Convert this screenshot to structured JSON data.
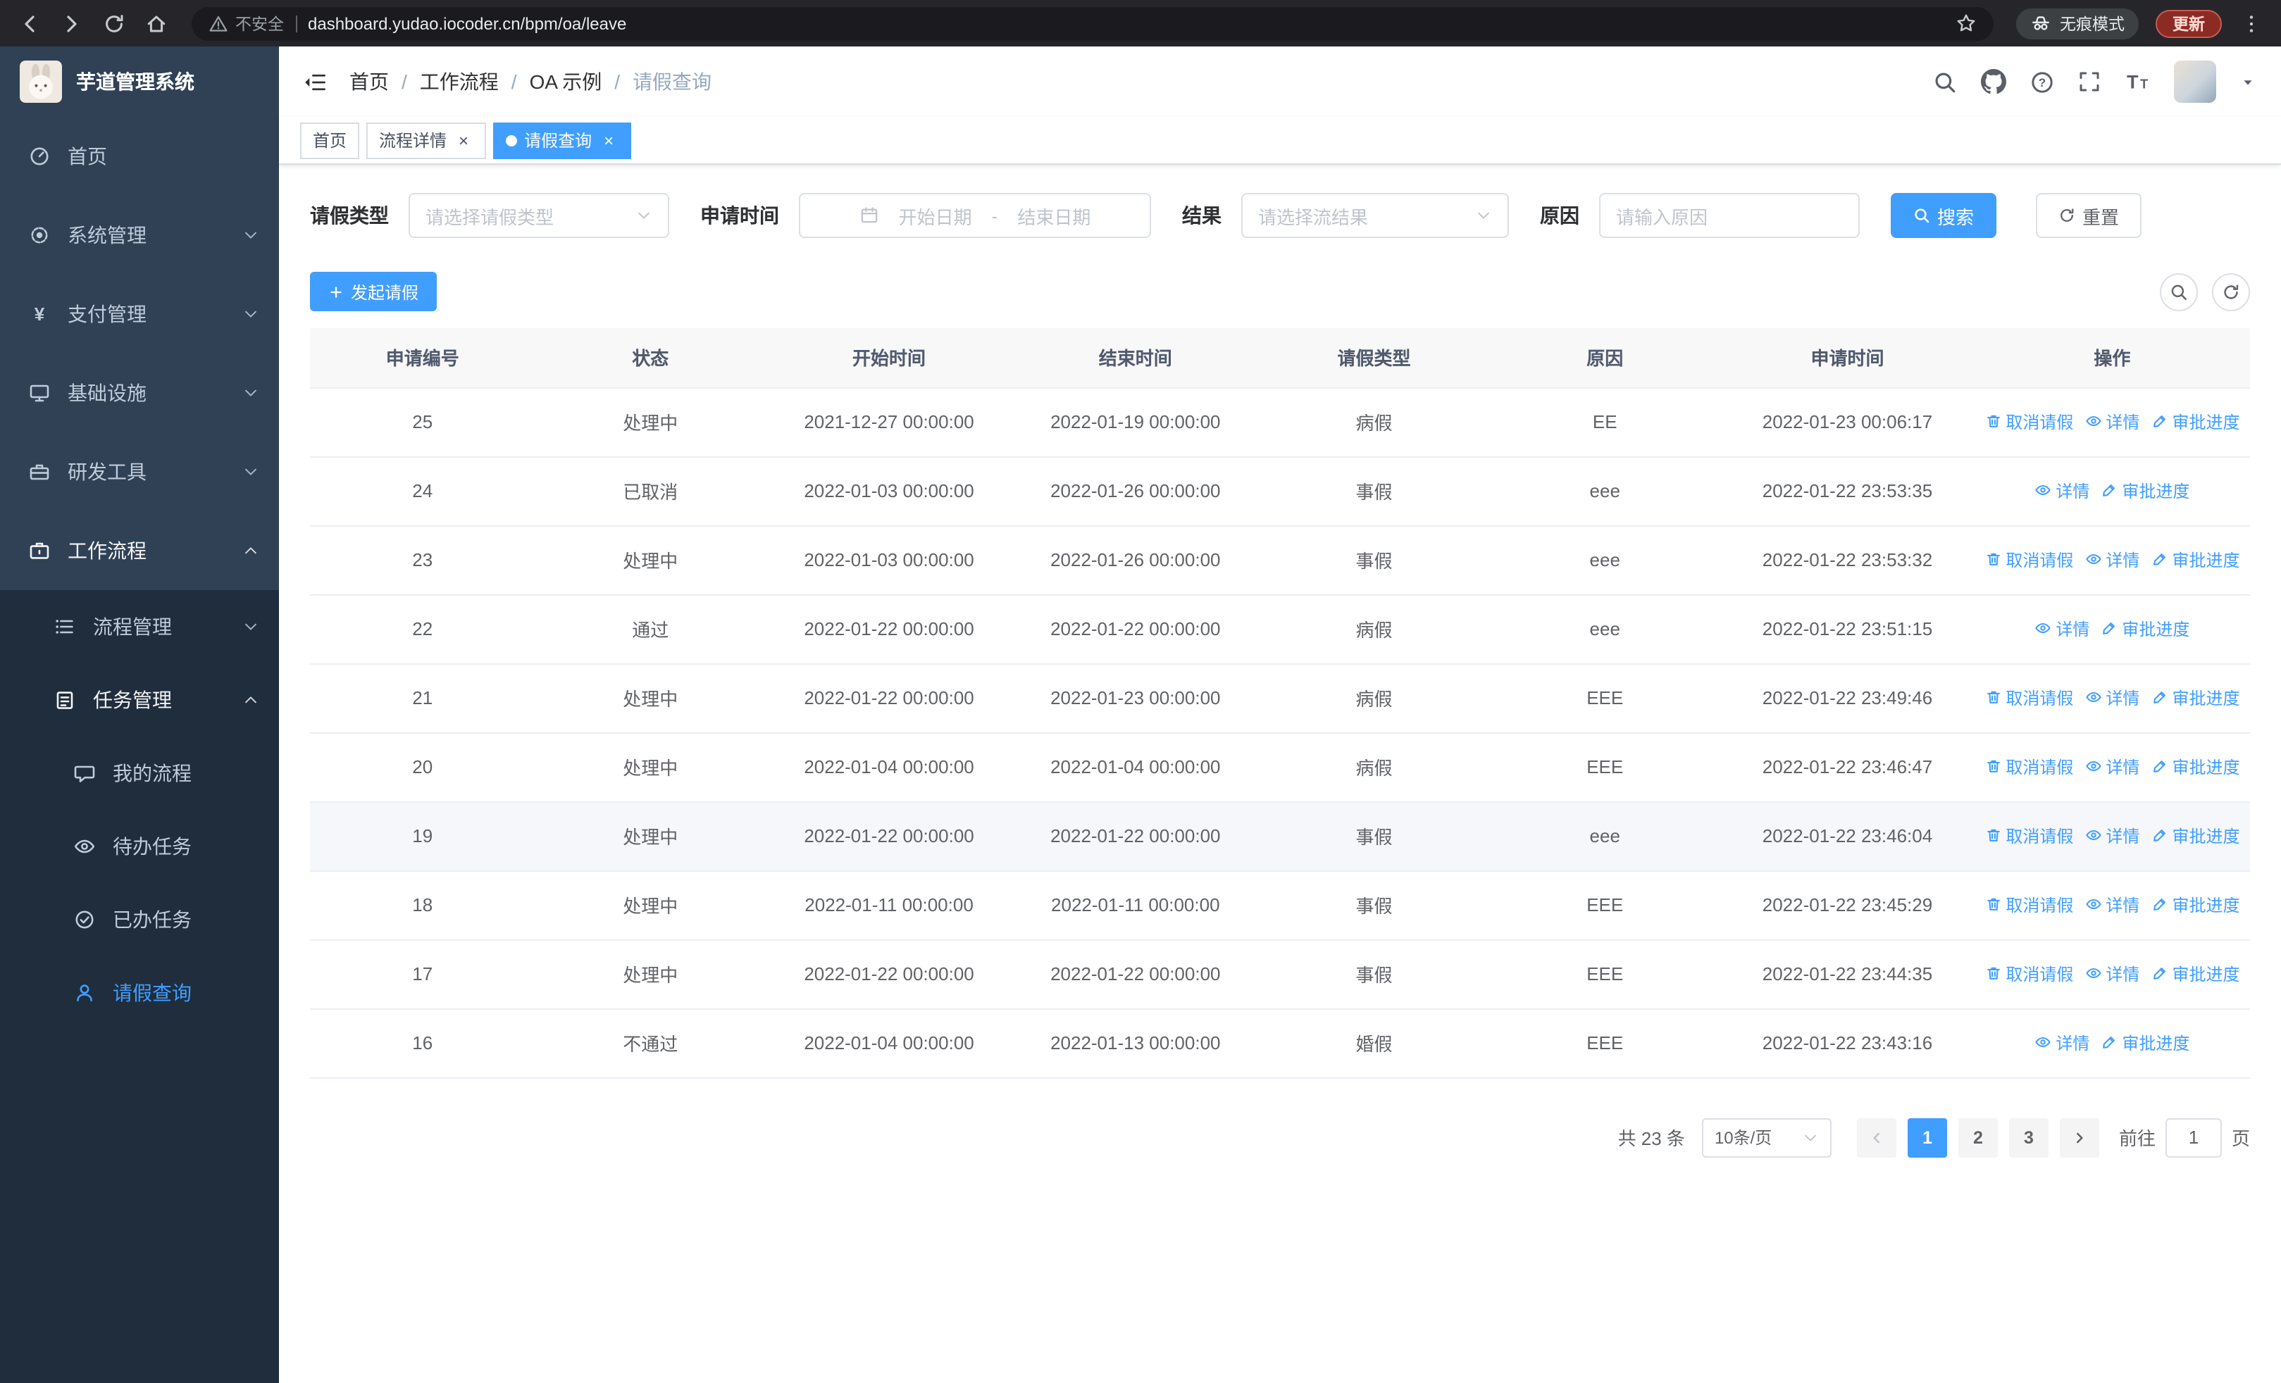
{
  "colors": {
    "primary": "#409eff",
    "sidebar_bg": "#304156",
    "sidebar_submenu_bg": "#1f2d3d"
  },
  "browser": {
    "security_warning": "不安全",
    "url": "dashboard.yudao.iocoder.cn/bpm/oa/leave",
    "incognito_label": "无痕模式",
    "update_label": "更新"
  },
  "sidebar": {
    "app_title": "芋道管理系统",
    "menu": [
      {
        "label": "首页",
        "icon": "dashboard-icon",
        "level": 1
      },
      {
        "label": "系统管理",
        "icon": "gear-icon",
        "level": 1,
        "chevron": "down"
      },
      {
        "label": "支付管理",
        "icon": "yen-icon",
        "level": 1,
        "chevron": "down"
      },
      {
        "label": "基础设施",
        "icon": "infra-icon",
        "level": 1,
        "chevron": "down"
      },
      {
        "label": "研发工具",
        "icon": "tools-icon",
        "level": 1,
        "chevron": "down"
      },
      {
        "label": "工作流程",
        "icon": "workflow-icon",
        "level": 1,
        "chevron": "up",
        "open": true
      },
      {
        "label": "流程管理",
        "icon": "process-icon",
        "level": 2,
        "chevron": "down"
      },
      {
        "label": "任务管理",
        "icon": "task-icon",
        "level": 2,
        "chevron": "up",
        "open": true
      },
      {
        "label": "我的流程",
        "icon": "chat-icon",
        "level": 3
      },
      {
        "label": "待办任务",
        "icon": "eye-icon",
        "level": 3
      },
      {
        "label": "已办任务",
        "icon": "done-tasks-icon",
        "level": 3
      },
      {
        "label": "请假查询",
        "icon": "user-icon",
        "level": 3,
        "active": true
      }
    ]
  },
  "header": {
    "breadcrumb": [
      "首页",
      "工作流程",
      "OA 示例",
      "请假查询"
    ]
  },
  "tags": [
    {
      "label": "首页",
      "closable": false,
      "active": false
    },
    {
      "label": "流程详情",
      "closable": true,
      "active": false
    },
    {
      "label": "请假查询",
      "closable": true,
      "active": true
    }
  ],
  "filters": {
    "leave_type_label": "请假类型",
    "leave_type_placeholder": "请选择请假类型",
    "apply_time_label": "申请时间",
    "start_date_placeholder": "开始日期",
    "range_separator": "-",
    "end_date_placeholder": "结束日期",
    "result_label": "结果",
    "result_placeholder": "请选择流结果",
    "reason_label": "原因",
    "reason_placeholder": "请输入原因",
    "search_button": "搜索",
    "reset_button": "重置"
  },
  "toolbar": {
    "create_button": "发起请假"
  },
  "table": {
    "columns": [
      "申请编号",
      "状态",
      "开始时间",
      "结束时间",
      "请假类型",
      "原因",
      "申请时间",
      "操作"
    ],
    "actions": {
      "cancel": "取消请假",
      "detail": "详情",
      "progress": "审批进度"
    },
    "action_icons": {
      "cancel": "trash-icon",
      "detail": "eye-icon",
      "progress": "edit-icon"
    },
    "rows": [
      {
        "id": "25",
        "status": "处理中",
        "start": "2021-12-27 00:00:00",
        "end": "2022-01-19 00:00:00",
        "type": "病假",
        "reason": "EE",
        "applied": "2022-01-23 00:06:17",
        "cancellable": true
      },
      {
        "id": "24",
        "status": "已取消",
        "start": "2022-01-03 00:00:00",
        "end": "2022-01-26 00:00:00",
        "type": "事假",
        "reason": "eee",
        "applied": "2022-01-22 23:53:35",
        "cancellable": false
      },
      {
        "id": "23",
        "status": "处理中",
        "start": "2022-01-03 00:00:00",
        "end": "2022-01-26 00:00:00",
        "type": "事假",
        "reason": "eee",
        "applied": "2022-01-22 23:53:32",
        "cancellable": true
      },
      {
        "id": "22",
        "status": "通过",
        "start": "2022-01-22 00:00:00",
        "end": "2022-01-22 00:00:00",
        "type": "病假",
        "reason": "eee",
        "applied": "2022-01-22 23:51:15",
        "cancellable": false
      },
      {
        "id": "21",
        "status": "处理中",
        "start": "2022-01-22 00:00:00",
        "end": "2022-01-23 00:00:00",
        "type": "病假",
        "reason": "EEE",
        "applied": "2022-01-22 23:49:46",
        "cancellable": true
      },
      {
        "id": "20",
        "status": "处理中",
        "start": "2022-01-04 00:00:00",
        "end": "2022-01-04 00:00:00",
        "type": "病假",
        "reason": "EEE",
        "applied": "2022-01-22 23:46:47",
        "cancellable": true
      },
      {
        "id": "19",
        "status": "处理中",
        "start": "2022-01-22 00:00:00",
        "end": "2022-01-22 00:00:00",
        "type": "事假",
        "reason": "eee",
        "applied": "2022-01-22 23:46:04",
        "cancellable": true,
        "highlighted": true
      },
      {
        "id": "18",
        "status": "处理中",
        "start": "2022-01-11 00:00:00",
        "end": "2022-01-11 00:00:00",
        "type": "事假",
        "reason": "EEE",
        "applied": "2022-01-22 23:45:29",
        "cancellable": true
      },
      {
        "id": "17",
        "status": "处理中",
        "start": "2022-01-22 00:00:00",
        "end": "2022-01-22 00:00:00",
        "type": "事假",
        "reason": "EEE",
        "applied": "2022-01-22 23:44:35",
        "cancellable": true
      },
      {
        "id": "16",
        "status": "不通过",
        "start": "2022-01-04 00:00:00",
        "end": "2022-01-13 00:00:00",
        "type": "婚假",
        "reason": "EEE",
        "applied": "2022-01-22 23:43:16",
        "cancellable": false
      }
    ]
  },
  "pagination": {
    "total": "共 23 条",
    "page_size": "10条/页",
    "pages": [
      "1",
      "2",
      "3"
    ],
    "active_page": "1",
    "goto_label": "前往",
    "goto_value": "1",
    "page_label": "页"
  }
}
